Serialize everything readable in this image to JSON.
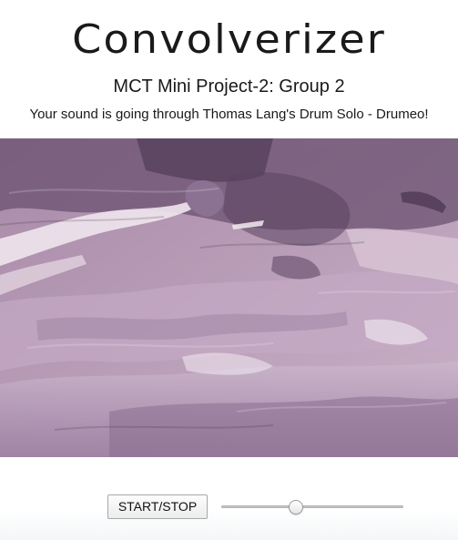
{
  "header": {
    "title": "Convolverizer",
    "subtitle": "MCT Mini Project-2: Group 2",
    "status": "Your sound is going through Thomas Lang's Drum Solo - Drumeo!"
  },
  "artwork": {
    "icon": "painted-drum-kit-image",
    "palette": [
      "#8a6a8e",
      "#b79ab5",
      "#d8c2d0",
      "#5e4764",
      "#e9dde6"
    ]
  },
  "controls": {
    "start_stop_label": "START/STOP",
    "slider_value": 0.4,
    "slider_min": 0,
    "slider_max": 1
  }
}
